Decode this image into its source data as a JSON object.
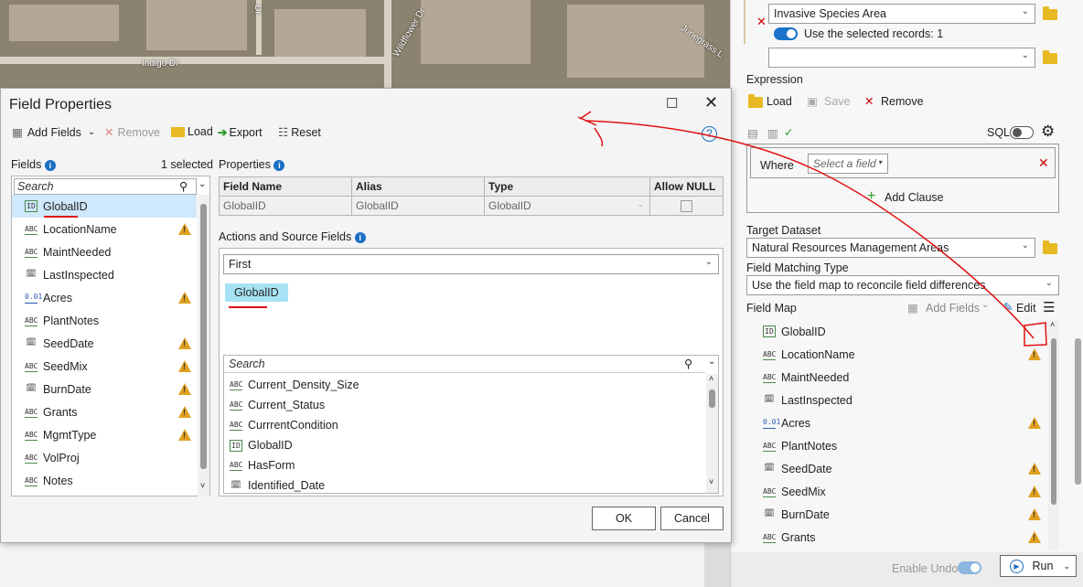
{
  "map": {
    "street_labels": [
      "Indigo Dr",
      "Wildflower Dr",
      "Dr",
      "Junegrass L"
    ]
  },
  "dialog": {
    "title": "Field Properties",
    "toolbar": {
      "add_fields": "Add Fields",
      "remove": "Remove",
      "load": "Load",
      "export": "Export",
      "reset": "Reset"
    },
    "fields": {
      "label": "Fields",
      "selected_count": "1 selected",
      "search_placeholder": "Search",
      "items": [
        {
          "name": "GlobalID",
          "type": "ID",
          "warn": false
        },
        {
          "name": "LocationName",
          "type": "ABC",
          "warn": true
        },
        {
          "name": "MaintNeeded",
          "type": "ABC",
          "warn": false
        },
        {
          "name": "LastInspected",
          "type": "DATE",
          "warn": false
        },
        {
          "name": "Acres",
          "type": "0.01",
          "warn": true
        },
        {
          "name": "PlantNotes",
          "type": "ABC",
          "warn": false
        },
        {
          "name": "SeedDate",
          "type": "DATE",
          "warn": true
        },
        {
          "name": "SeedMix",
          "type": "ABC",
          "warn": true
        },
        {
          "name": "BurnDate",
          "type": "DATE",
          "warn": true
        },
        {
          "name": "Grants",
          "type": "ABC",
          "warn": true
        },
        {
          "name": "MgmtType",
          "type": "ABC",
          "warn": true
        },
        {
          "name": "VolProj",
          "type": "ABC",
          "warn": false
        },
        {
          "name": "Notes",
          "type": "ABC",
          "warn": false
        }
      ]
    },
    "properties": {
      "label": "Properties",
      "headers": [
        "Field Name",
        "Alias",
        "Type",
        "Allow NULL"
      ],
      "row": {
        "field_name": "GlobalID",
        "alias": "GlobalID",
        "type": "GlobalID"
      }
    },
    "actions": {
      "label": "Actions and Source Fields",
      "selected": "First",
      "chip": "GlobalID",
      "search_placeholder": "Search",
      "source_fields": [
        {
          "name": "Current_Density_Size",
          "type": "ABC"
        },
        {
          "name": "Current_Status",
          "type": "ABC"
        },
        {
          "name": "CurrrentCondition",
          "type": "ABC"
        },
        {
          "name": "GlobalID",
          "type": "ID"
        },
        {
          "name": "HasForm",
          "type": "ABC"
        },
        {
          "name": "Identified_Date",
          "type": "DATE"
        }
      ]
    },
    "ok": "OK",
    "cancel": "Cancel"
  },
  "pane": {
    "input_dataset": "Invasive Species Area",
    "use_selected": "Use the selected records: 1",
    "expression_label": "Expression",
    "load": "Load",
    "save": "Save",
    "remove": "Remove",
    "sql": "SQL",
    "where": "Where",
    "select_field": "Select a field",
    "add_clause": "Add Clause",
    "target_label": "Target Dataset",
    "target_value": "Natural Resources Management Areas",
    "matching_label": "Field Matching Type",
    "matching_value": "Use the field map to reconcile field differences",
    "fieldmap_label": "Field Map",
    "add_fields": "Add Fields",
    "edit": "Edit",
    "fieldmap_items": [
      {
        "name": "GlobalID",
        "type": "ID",
        "warn": false
      },
      {
        "name": "LocationName",
        "type": "ABC",
        "warn": true
      },
      {
        "name": "MaintNeeded",
        "type": "ABC",
        "warn": false
      },
      {
        "name": "LastInspected",
        "type": "DATE",
        "warn": false
      },
      {
        "name": "Acres",
        "type": "0.01",
        "warn": true
      },
      {
        "name": "PlantNotes",
        "type": "ABC",
        "warn": false
      },
      {
        "name": "SeedDate",
        "type": "DATE",
        "warn": true
      },
      {
        "name": "SeedMix",
        "type": "ABC",
        "warn": true
      },
      {
        "name": "BurnDate",
        "type": "DATE",
        "warn": true
      },
      {
        "name": "Grants",
        "type": "ABC",
        "warn": true
      }
    ],
    "enable_undo": "Enable Undo",
    "run": "Run"
  }
}
